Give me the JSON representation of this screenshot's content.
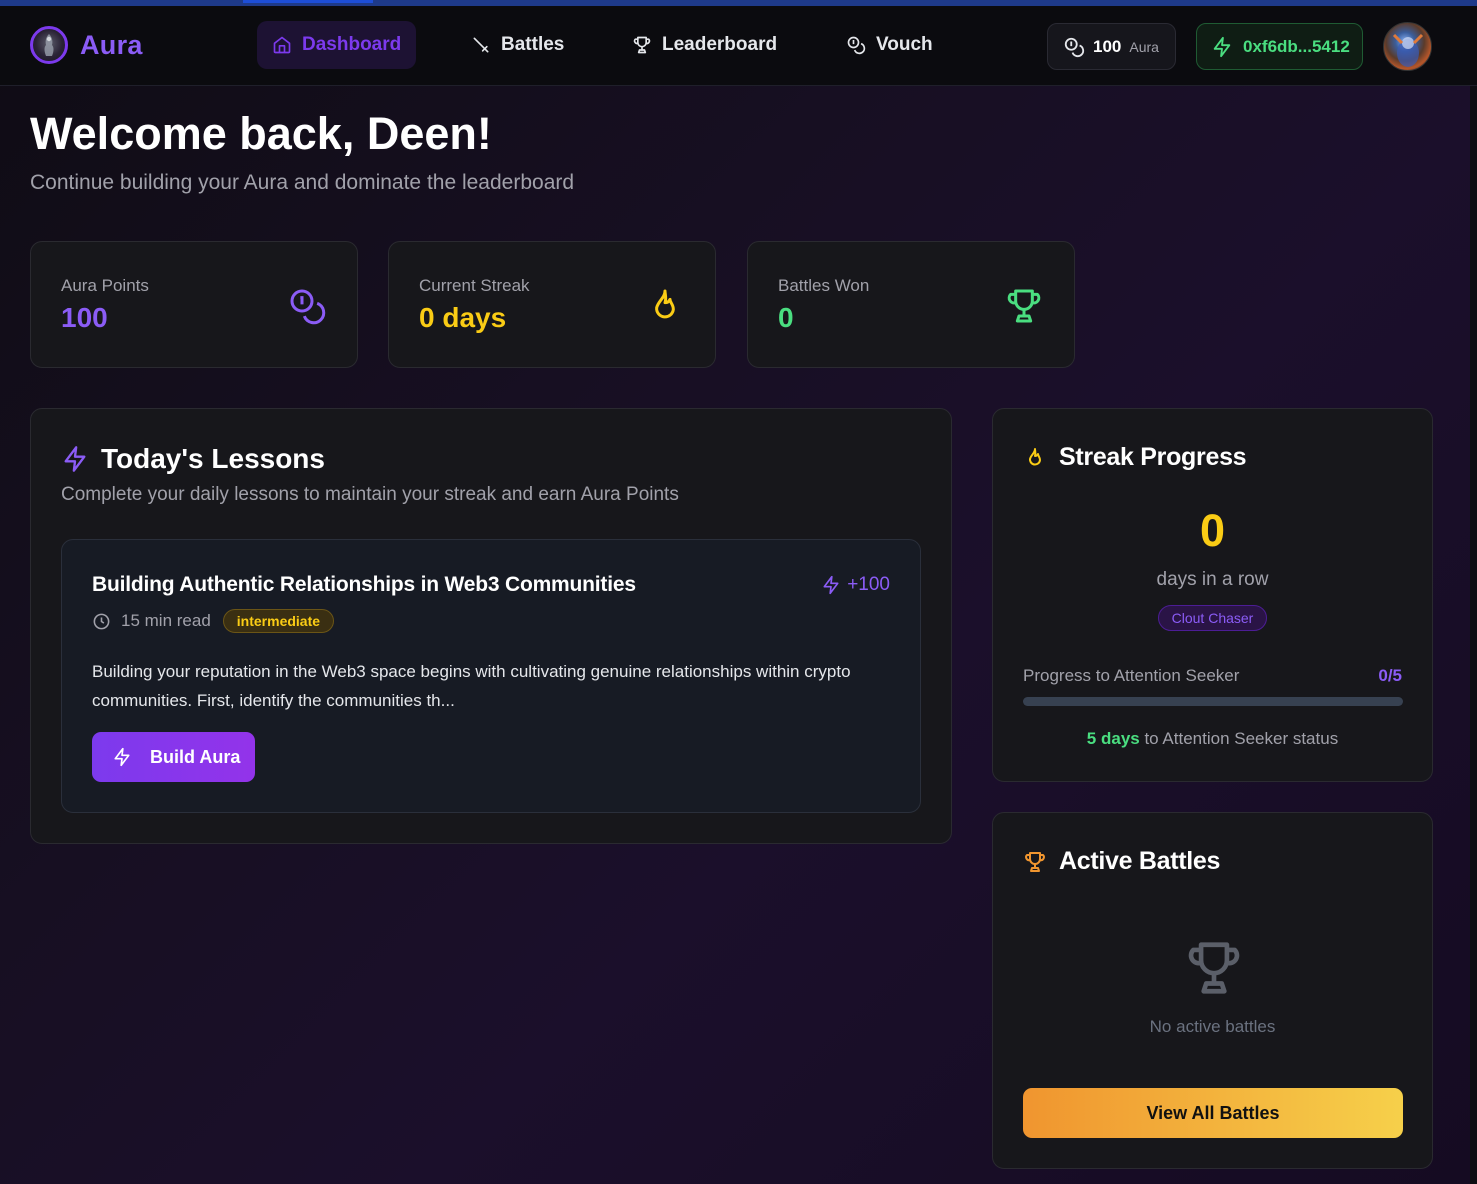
{
  "brand": {
    "name": "Aura"
  },
  "nav": {
    "items": [
      {
        "label": "Dashboard",
        "icon": "home-icon",
        "active": true
      },
      {
        "label": "Battles",
        "icon": "sword-icon",
        "active": false
      },
      {
        "label": "Leaderboard",
        "icon": "trophy-icon",
        "active": false
      },
      {
        "label": "Vouch",
        "icon": "coins-icon",
        "active": false
      }
    ],
    "points": {
      "value": "100",
      "unit": "Aura"
    },
    "wallet": {
      "address": "0xf6db...5412"
    }
  },
  "header": {
    "title": "Welcome back, Deen!",
    "subtitle": "Continue building your Aura and dominate the leaderboard"
  },
  "stats": [
    {
      "label": "Aura Points",
      "value": "100",
      "color": "#8b5cf6",
      "icon": "coins-icon"
    },
    {
      "label": "Current Streak",
      "value": "0 days",
      "color": "#facc15",
      "icon": "flame-icon"
    },
    {
      "label": "Battles Won",
      "value": "0",
      "color": "#4ade80",
      "icon": "trophy-icon"
    }
  ],
  "lessons": {
    "title": "Today's Lessons",
    "subtitle": "Complete your daily lessons to maintain your streak and earn Aura Points",
    "lesson": {
      "title": "Building Authentic Relationships in Web3 Communities",
      "points": "+100",
      "read_time": "15 min read",
      "level": "intermediate",
      "excerpt": "Building your reputation in the Web3 space begins with cultivating genuine relationships within crypto communities. First, identify the communities th...",
      "button": "Build Aura"
    }
  },
  "streak": {
    "title": "Streak Progress",
    "count": "0",
    "unit": "days in a row",
    "rank": "Clout Chaser",
    "progress_label": "Progress to Attention Seeker",
    "progress_count": "0/5",
    "progress_fraction": 0,
    "note_days": "5 days",
    "note_rest": " to Attention Seeker status"
  },
  "battles": {
    "title": "Active Battles",
    "empty": "No active battles",
    "button": "View All Battles"
  },
  "colors": {
    "accent": "#8b5cf6",
    "streak": "#facc15",
    "success": "#4ade80",
    "battle": "#f0952f"
  }
}
